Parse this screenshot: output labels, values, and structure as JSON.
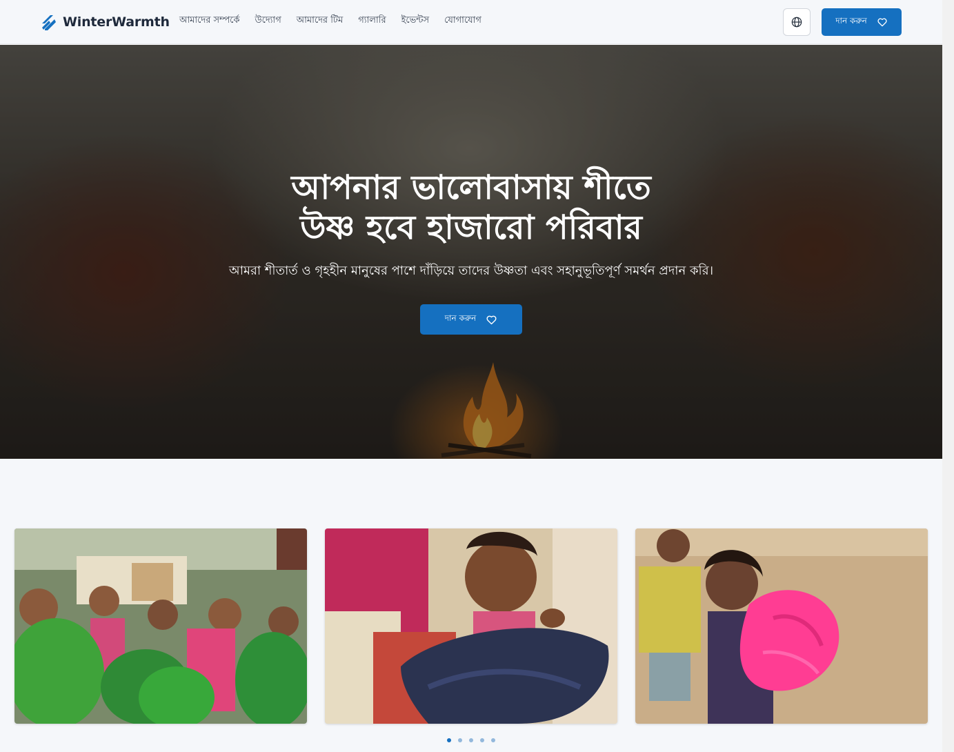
{
  "brand": {
    "name": "WinterWarmth",
    "logo_icon": "double-slash-logo-icon",
    "color": "#1570c0"
  },
  "nav": {
    "items": [
      {
        "label": "আমাদের সম্পর্কে"
      },
      {
        "label": "উদ্যোগ"
      },
      {
        "label": "আমাদের টিম"
      },
      {
        "label": "গ্যালারি"
      },
      {
        "label": "ইভেন্টস"
      },
      {
        "label": "যোগাযোগ"
      }
    ],
    "language_icon": "globe-icon",
    "donate_label": "দান করুন",
    "donate_icon": "heart-icon"
  },
  "hero": {
    "title_line1": "আপনার ভালোবাসায় শীতে",
    "title_line2": "উষ্ণ হবে হাজারো পরিবার",
    "subtitle": "আমরা শীতার্ত ও গৃহহীন মানুষের পাশে দাঁড়িয়ে তাদের উষ্ণতা এবং সহানুভূতিপূর্ণ সমর্থন প্রদান করি।",
    "donate_label": "দান করুন",
    "donate_icon": "heart-icon"
  },
  "carousel": {
    "slides": [
      {
        "alt": "children-holding-green-blankets"
      },
      {
        "alt": "girl-holding-dark-blanket"
      },
      {
        "alt": "girl-holding-pink-blanket"
      }
    ],
    "dots": [
      {
        "active": true
      },
      {
        "active": false
      },
      {
        "active": false
      },
      {
        "active": false
      },
      {
        "active": false
      }
    ]
  },
  "colors": {
    "primary": "#1570c0",
    "page_background": "#f5f7fa"
  }
}
